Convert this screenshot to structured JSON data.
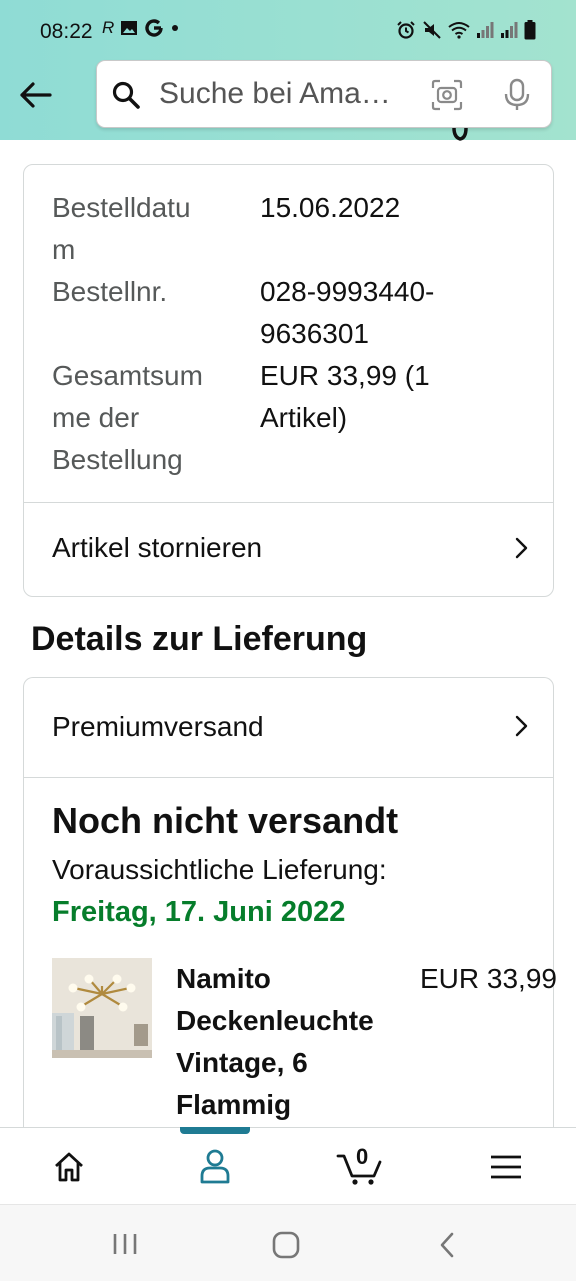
{
  "status_bar": {
    "time": "08:22",
    "left_icons": [
      "r-icon",
      "image-icon",
      "google-icon",
      "dot-icon"
    ],
    "right_icons": [
      "alarm-icon",
      "mute-icon",
      "wifi-icon",
      "signal-icon",
      "signal-icon-2",
      "battery-icon"
    ]
  },
  "header": {
    "search_placeholder": "Suche bei Ama…",
    "icons": [
      "back-arrow-icon",
      "search-icon",
      "camera-icon",
      "mic-icon"
    ]
  },
  "order_details": {
    "rows": [
      {
        "label": "Bestelldatu\nm",
        "value": "15.06.2022"
      },
      {
        "label": "Bestellnr.",
        "value": "028-9993440-\n9636301"
      },
      {
        "label": "Gesamtsum\nme der\nBestellung",
        "value": "EUR 33,99 (1\nArtikel)"
      }
    ],
    "cancel_link": "Artikel stornieren"
  },
  "delivery": {
    "section_title": "Details zur Lieferung",
    "shipping_method": "Premiumversand",
    "status": "Noch nicht versandt",
    "expected_label": "Voraussichtliche Lieferung:",
    "expected_date": "Freitag, 17. Juni 2022",
    "expected_date_color": "#067d2b",
    "item": {
      "name": "Namito Deckenleuchte Vintage, 6 Flammig",
      "price": "EUR 33,99"
    }
  },
  "bottom_nav": {
    "items": [
      "home-icon",
      "account-icon",
      "cart-icon",
      "menu-icon"
    ],
    "active": "account-icon",
    "active_color": "#1f7b93",
    "cart_count": "0"
  },
  "system_nav": [
    "recents-icon",
    "home-button-icon",
    "back-icon"
  ]
}
